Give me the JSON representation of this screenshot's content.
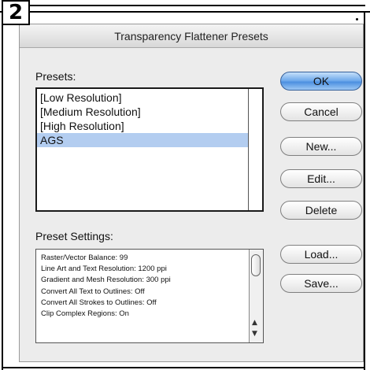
{
  "step": "2",
  "dialog": {
    "title": "Transparency Flattener Presets"
  },
  "presets": {
    "label": "Presets:",
    "items": [
      "[Low Resolution]",
      "[Medium Resolution]",
      "[High Resolution]",
      "AGS"
    ],
    "selected": "AGS"
  },
  "settings": {
    "label": "Preset Settings:",
    "lines": [
      "Raster/Vector Balance: 99",
      "Line Art and Text Resolution: 1200 ppi",
      "Gradient and Mesh Resolution: 300 ppi",
      "Convert All Text to Outlines: Off",
      "Convert All Strokes to Outlines: Off",
      "Clip Complex Regions: On"
    ]
  },
  "buttons": {
    "ok": "OK",
    "cancel": "Cancel",
    "new": "New...",
    "edit": "Edit...",
    "delete": "Delete",
    "load": "Load...",
    "save": "Save..."
  },
  "colors": {
    "selection": "#b3cdf0",
    "default_button": "#4b8fe0"
  }
}
